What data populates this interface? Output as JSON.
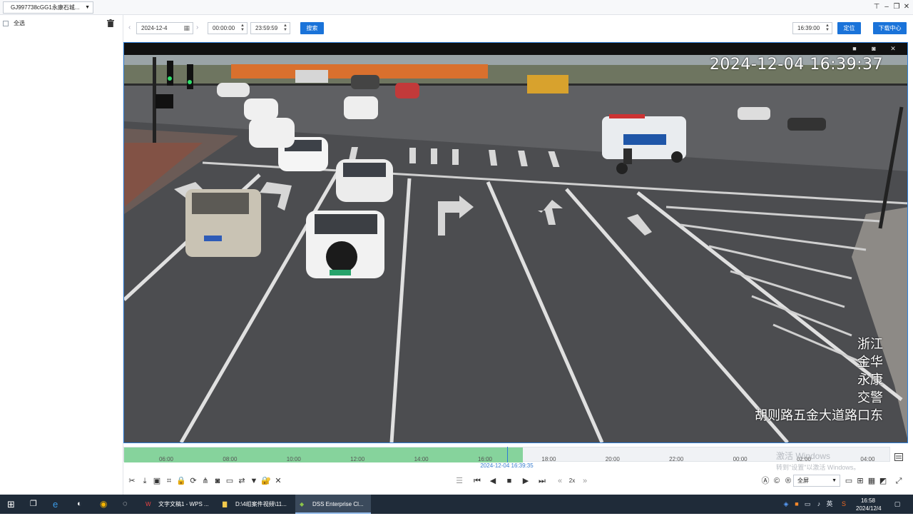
{
  "window": {
    "device_label": "GJ997738cGG1永康石城...",
    "controls": [
      "pin-icon",
      "minimize-icon",
      "restore-icon",
      "close-icon"
    ]
  },
  "leftpanel": {
    "select_all": "全选"
  },
  "toolbar": {
    "date": "2024-12-4",
    "start_time": "00:00:00",
    "end_time": "23:59:59",
    "search": "搜索",
    "locate_time": "16:39:00",
    "locate": "定位",
    "download_center": "下载中心"
  },
  "video": {
    "osd_timestamp": "2024-12-04 16:39:37",
    "osd_lines": [
      "浙江",
      "金华",
      "永康",
      "交警",
      "胡则路五金大道路口东"
    ]
  },
  "timeline": {
    "ticks": [
      "06:00",
      "08:00",
      "10:00",
      "12:00",
      "14:00",
      "16:00",
      "18:00",
      "20:00",
      "22:00",
      "00:00",
      "02:00",
      "04:00"
    ],
    "current_label": "2024-12-04 16:39:35",
    "recorded_until_fraction": 0.52,
    "cursor_fraction": 0.5
  },
  "watermark": {
    "line1": "激活 Windows",
    "line2": "转到\"设置\"以激活 Windows。"
  },
  "controls": {
    "speed": "2x",
    "fullscreen": "全屏"
  },
  "taskbar": {
    "apps": [
      "文字文稿1 - WPS ...",
      "D:\\4组案件视频\\11...",
      "DSS Enterprise Cl..."
    ],
    "ime": "英",
    "time": "16:58",
    "date": "2024/12/4"
  }
}
